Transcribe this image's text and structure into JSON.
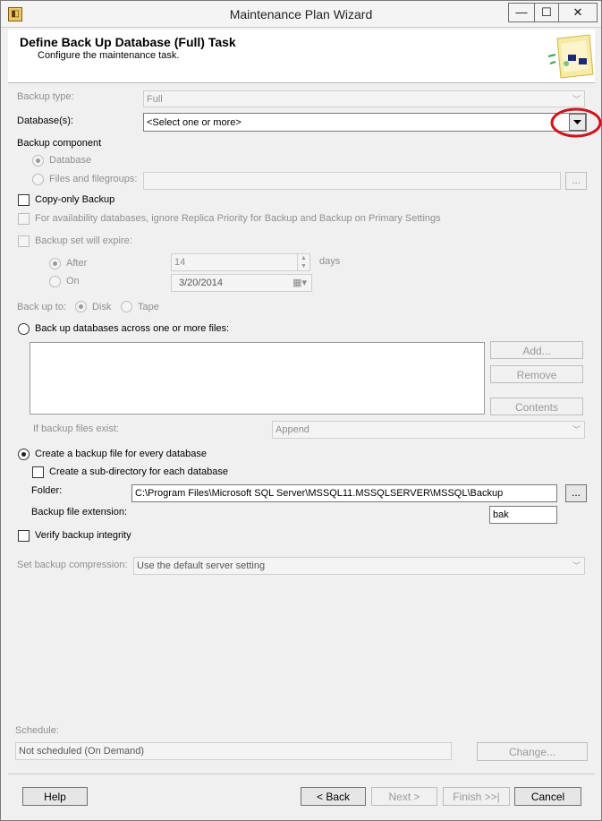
{
  "window": {
    "title": "Maintenance Plan Wizard",
    "minimize": "—",
    "maximize": "☐",
    "close": "✕",
    "app_icon": "wizard-app-icon"
  },
  "header": {
    "title": "Define Back Up Database (Full) Task",
    "subtitle": "Configure the maintenance task."
  },
  "backup_type": {
    "label": "Backup type:",
    "value": "Full"
  },
  "databases": {
    "label": "Database(s):",
    "value": "<Select one or more>"
  },
  "component": {
    "label": "Backup component",
    "database": "Database",
    "files": "Files and filegroups:",
    "browse": "..."
  },
  "copy_only": {
    "label": "Copy-only Backup"
  },
  "availability": {
    "label": "For availability databases, ignore Replica Priority for Backup and Backup on Primary Settings"
  },
  "expire": {
    "label": "Backup set will expire:",
    "after": "After",
    "after_value": "14",
    "days": "days",
    "on": "On",
    "on_value": "3/20/2014"
  },
  "backup_to": {
    "label": "Back up to:",
    "disk": "Disk",
    "tape": "Tape"
  },
  "across_files": {
    "label": "Back up databases across one or more files:",
    "add": "Add...",
    "remove": "Remove",
    "contents": "Contents",
    "if_exist_label": "If backup files exist:",
    "if_exist_value": "Append"
  },
  "every_db": {
    "label": "Create a backup file for every database",
    "subdir": "Create a sub-directory for each database",
    "folder_label": "Folder:",
    "folder_value": "C:\\Program Files\\Microsoft SQL Server\\MSSQL11.MSSQLSERVER\\MSSQL\\Backup",
    "browse": "...",
    "ext_label": "Backup file extension:",
    "ext_value": "bak"
  },
  "verify": {
    "label": "Verify backup integrity"
  },
  "compression": {
    "label": "Set backup compression:",
    "value": "Use the default server setting"
  },
  "schedule": {
    "label": "Schedule:",
    "value": "Not scheduled (On Demand)",
    "change": "Change..."
  },
  "footer": {
    "help": "Help",
    "back": "< Back",
    "next": "Next >",
    "finish": "Finish >>|",
    "cancel": "Cancel"
  },
  "colors": {
    "annotation": "#d3131b",
    "disabled_text": "#8f8f8f"
  }
}
